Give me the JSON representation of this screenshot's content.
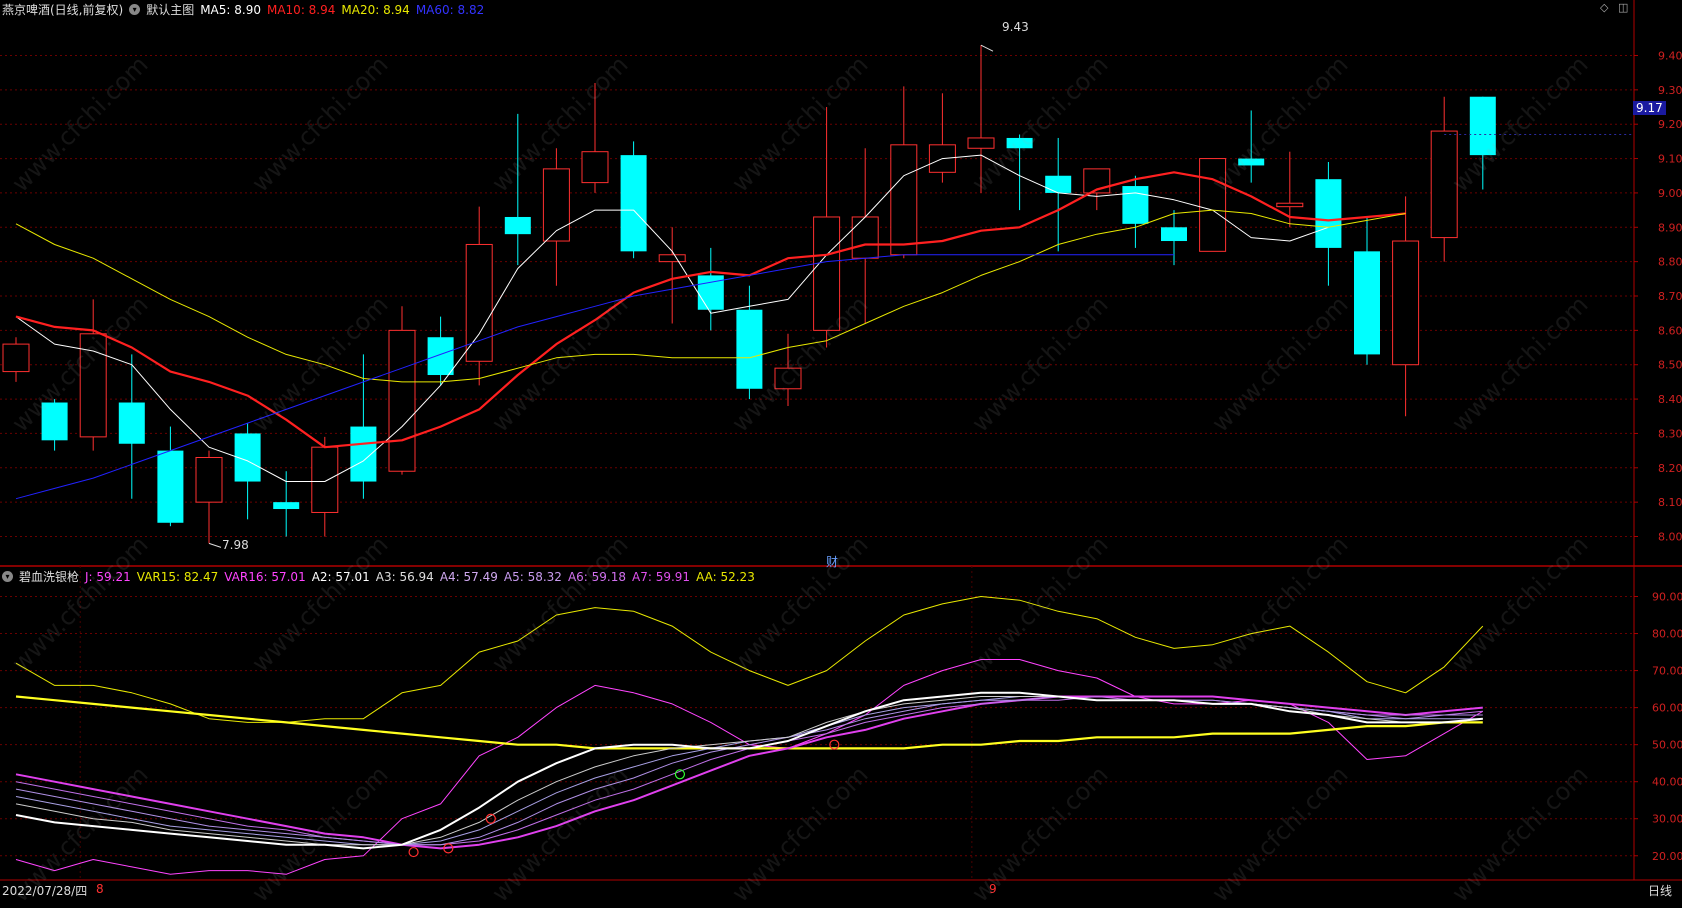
{
  "header": {
    "stock": "燕京啤酒(日线,前复权)",
    "main_chart": "默认主图",
    "ma": [
      {
        "label": "MA5: 8.90",
        "color": "#ffffff"
      },
      {
        "label": "MA10: 8.94",
        "color": "#ff2020"
      },
      {
        "label": "MA20: 8.94",
        "color": "#e8e800"
      },
      {
        "label": "MA60: 8.82",
        "color": "#2222ff"
      }
    ]
  },
  "indicator_header": {
    "name": "碧血洗银枪",
    "items": [
      {
        "label": "J: 59.21",
        "color": "#ff44ff"
      },
      {
        "label": "VAR15: 82.47",
        "color": "#e8e800"
      },
      {
        "label": "VAR16: 57.01",
        "color": "#ff44ff"
      },
      {
        "label": "A2: 57.01",
        "color": "#ffffff"
      },
      {
        "label": "A3: 56.94",
        "color": "#dddddd"
      },
      {
        "label": "A4: 57.49",
        "color": "#cfa8ef"
      },
      {
        "label": "A5: 58.32",
        "color": "#c79aee"
      },
      {
        "label": "A6: 59.18",
        "color": "#d070ee"
      },
      {
        "label": "A7: 59.91",
        "color": "#e050ee"
      },
      {
        "label": "AA: 52.23",
        "color": "#e8e800"
      }
    ]
  },
  "footer": {
    "date": "2022/07/28/四",
    "month_markers": [
      "8",
      "9"
    ],
    "period": "日线",
    "finance_marker": "财"
  },
  "price_labels": {
    "current": "9.17",
    "high": "9.43",
    "low": "7.98"
  },
  "watermark": "www.cfchi.com",
  "chart_data": [
    {
      "type": "candlestick",
      "ylim": [
        7.92,
        9.48
      ],
      "yticks": [
        "8.00",
        "8.10",
        "8.20",
        "8.30",
        "8.40",
        "8.50",
        "8.60",
        "8.70",
        "8.80",
        "8.90",
        "9.00",
        "9.10",
        "9.20",
        "9.30",
        "9.40"
      ],
      "candles": [
        {
          "o": 8.48,
          "c": 8.56,
          "h": 8.58,
          "l": 8.45
        },
        {
          "o": 8.39,
          "c": 8.28,
          "h": 8.4,
          "l": 8.25
        },
        {
          "o": 8.29,
          "c": 8.59,
          "h": 8.69,
          "l": 8.25
        },
        {
          "o": 8.39,
          "c": 8.27,
          "h": 8.53,
          "l": 8.11
        },
        {
          "o": 8.25,
          "c": 8.04,
          "h": 8.32,
          "l": 8.03
        },
        {
          "o": 8.1,
          "c": 8.23,
          "h": 8.25,
          "l": 7.98
        },
        {
          "o": 8.3,
          "c": 8.16,
          "h": 8.33,
          "l": 8.05
        },
        {
          "o": 8.1,
          "c": 8.08,
          "h": 8.19,
          "l": 8.0
        },
        {
          "o": 8.07,
          "c": 8.26,
          "h": 8.29,
          "l": 8.0
        },
        {
          "o": 8.32,
          "c": 8.16,
          "h": 8.53,
          "l": 8.11
        },
        {
          "o": 8.19,
          "c": 8.6,
          "h": 8.67,
          "l": 8.18
        },
        {
          "o": 8.58,
          "c": 8.47,
          "h": 8.64,
          "l": 8.44
        },
        {
          "o": 8.51,
          "c": 8.85,
          "h": 8.96,
          "l": 8.44
        },
        {
          "o": 8.93,
          "c": 8.88,
          "h": 9.23,
          "l": 8.79
        },
        {
          "o": 8.86,
          "c": 9.07,
          "h": 9.13,
          "l": 8.73
        },
        {
          "o": 9.03,
          "c": 9.12,
          "h": 9.32,
          "l": 9.0
        },
        {
          "o": 9.11,
          "c": 8.83,
          "h": 9.15,
          "l": 8.81
        },
        {
          "o": 8.8,
          "c": 8.82,
          "h": 8.9,
          "l": 8.62
        },
        {
          "o": 8.76,
          "c": 8.66,
          "h": 8.84,
          "l": 8.6
        },
        {
          "o": 8.66,
          "c": 8.43,
          "h": 8.73,
          "l": 8.4
        },
        {
          "o": 8.43,
          "c": 8.49,
          "h": 8.59,
          "l": 8.38
        },
        {
          "o": 8.6,
          "c": 8.93,
          "h": 9.25,
          "l": 8.55
        },
        {
          "o": 8.81,
          "c": 8.93,
          "h": 9.13,
          "l": 8.62
        },
        {
          "o": 8.82,
          "c": 9.14,
          "h": 9.31,
          "l": 8.81
        },
        {
          "o": 9.06,
          "c": 9.14,
          "h": 9.29,
          "l": 9.03
        },
        {
          "o": 9.13,
          "c": 9.16,
          "h": 9.43,
          "l": 9.0
        },
        {
          "o": 9.16,
          "c": 9.13,
          "h": 9.17,
          "l": 8.95
        },
        {
          "o": 9.05,
          "c": 9.0,
          "h": 9.16,
          "l": 8.83
        },
        {
          "o": 9.0,
          "c": 9.07,
          "h": 9.07,
          "l": 8.95
        },
        {
          "o": 9.02,
          "c": 8.91,
          "h": 9.05,
          "l": 8.84
        },
        {
          "o": 8.9,
          "c": 8.86,
          "h": 8.95,
          "l": 8.79
        },
        {
          "o": 8.83,
          "c": 9.1,
          "h": 9.1,
          "l": 8.83
        },
        {
          "o": 9.1,
          "c": 9.08,
          "h": 9.24,
          "l": 9.03
        },
        {
          "o": 8.96,
          "c": 8.97,
          "h": 9.12,
          "l": 8.9
        },
        {
          "o": 9.04,
          "c": 8.84,
          "h": 9.09,
          "l": 8.73
        },
        {
          "o": 8.83,
          "c": 8.53,
          "h": 8.93,
          "l": 8.5
        },
        {
          "o": 8.5,
          "c": 8.86,
          "h": 8.99,
          "l": 8.35
        },
        {
          "o": 8.87,
          "c": 9.18,
          "h": 9.28,
          "l": 8.8
        },
        {
          "o": 9.28,
          "c": 9.11,
          "h": 9.28,
          "l": 9.01
        }
      ],
      "series": [
        {
          "name": "MA5",
          "color": "#ffffff",
          "width": 1,
          "values": [
            8.64,
            8.56,
            8.54,
            8.5,
            8.37,
            8.26,
            8.22,
            8.16,
            8.16,
            8.22,
            8.32,
            8.44,
            8.59,
            8.78,
            8.89,
            8.95,
            8.95,
            8.83,
            8.65,
            8.67,
            8.69,
            8.82,
            8.93,
            9.05,
            9.1,
            9.11,
            9.05,
            9.0,
            8.99,
            9.0,
            8.98,
            8.95,
            8.87,
            8.86,
            8.9
          ]
        },
        {
          "name": "MA10",
          "color": "#ff2020",
          "width": 2.2,
          "values": [
            8.64,
            8.61,
            8.6,
            8.55,
            8.48,
            8.45,
            8.41,
            8.34,
            8.26,
            8.27,
            8.28,
            8.32,
            8.37,
            8.47,
            8.56,
            8.63,
            8.71,
            8.75,
            8.77,
            8.76,
            8.81,
            8.82,
            8.85,
            8.85,
            8.86,
            8.89,
            8.9,
            8.95,
            9.01,
            9.04,
            9.06,
            9.04,
            8.99,
            8.93,
            8.92,
            8.93,
            8.94
          ]
        },
        {
          "name": "MA20",
          "color": "#e8e800",
          "width": 1,
          "values": [
            8.91,
            8.85,
            8.81,
            8.75,
            8.69,
            8.64,
            8.58,
            8.53,
            8.5,
            8.46,
            8.45,
            8.45,
            8.46,
            8.49,
            8.52,
            8.53,
            8.53,
            8.52,
            8.52,
            8.52,
            8.55,
            8.57,
            8.62,
            8.67,
            8.71,
            8.76,
            8.8,
            8.85,
            8.88,
            8.9,
            8.94,
            8.95,
            8.94,
            8.91,
            8.9,
            8.92,
            8.94
          ]
        },
        {
          "name": "MA60",
          "color": "#2222ff",
          "width": 1,
          "values": [
            8.11,
            8.14,
            8.17,
            8.21,
            8.25,
            8.29,
            8.33,
            8.37,
            8.41,
            8.45,
            8.49,
            8.53,
            8.57,
            8.61,
            8.64,
            8.67,
            8.7,
            8.72,
            8.74,
            8.76,
            8.78,
            8.8,
            8.81,
            8.82,
            8.82,
            8.82,
            8.82,
            8.82,
            8.82,
            8.82,
            8.82
          ]
        }
      ]
    },
    {
      "type": "line",
      "ylim": [
        14,
        95
      ],
      "yticks": [
        "20.00",
        "30.00",
        "40.00",
        "50.00",
        "60.00",
        "70.00",
        "80.00",
        "90.00"
      ],
      "series": [
        {
          "name": "VAR15",
          "color": "#e8e800",
          "width": 1,
          "values": [
            72,
            66,
            66,
            64,
            61,
            57,
            56,
            56,
            57,
            57,
            64,
            66,
            75,
            78,
            85,
            87,
            86,
            82,
            75,
            70,
            66,
            70,
            78,
            85,
            88,
            90,
            89,
            86,
            84,
            79,
            76,
            77,
            80,
            82,
            75,
            67,
            64,
            71,
            82
          ]
        },
        {
          "name": "J",
          "color": "#ff44ff",
          "width": 1,
          "values": [
            19,
            16,
            19,
            17,
            15,
            16,
            16,
            15,
            19,
            20,
            30,
            34,
            47,
            52,
            60,
            66,
            64,
            61,
            56,
            50,
            49,
            53,
            58,
            66,
            70,
            73,
            73,
            70,
            68,
            63,
            61,
            61,
            62,
            61,
            56,
            46,
            47,
            53,
            59
          ]
        },
        {
          "name": "AA",
          "color": "#ffff20",
          "width": 2.2,
          "values": [
            63,
            62,
            61,
            60,
            59,
            58,
            57,
            56,
            55,
            54,
            53,
            52,
            51,
            50,
            50,
            49,
            49,
            49,
            49,
            49,
            49,
            49,
            49,
            49,
            50,
            50,
            51,
            51,
            52,
            52,
            52,
            53,
            53,
            53,
            54,
            55,
            55,
            56,
            56
          ]
        },
        {
          "name": "A7",
          "color": "#e040ee",
          "width": 2,
          "values": [
            42,
            40,
            38,
            36,
            34,
            32,
            30,
            28,
            26,
            25,
            23,
            22,
            23,
            25,
            28,
            32,
            35,
            39,
            43,
            47,
            49,
            52,
            54,
            57,
            59,
            61,
            62,
            63,
            63,
            63,
            63,
            63,
            62,
            61,
            60,
            59,
            58,
            59,
            60
          ]
        },
        {
          "name": "A6",
          "color": "#c070e8",
          "width": 1,
          "values": [
            40,
            38,
            36,
            34,
            32,
            30,
            28,
            27,
            25,
            24,
            23,
            23,
            24,
            27,
            31,
            35,
            38,
            42,
            46,
            49,
            51,
            53,
            56,
            58,
            60,
            61,
            62,
            62,
            63,
            62,
            62,
            62,
            61,
            60,
            59,
            58,
            58,
            58,
            59
          ]
        },
        {
          "name": "A5",
          "color": "#b090e6",
          "width": 1,
          "values": [
            38,
            36,
            34,
            32,
            30,
            28,
            27,
            26,
            25,
            24,
            23,
            23,
            25,
            29,
            34,
            38,
            41,
            45,
            48,
            50,
            52,
            54,
            57,
            59,
            61,
            62,
            62,
            63,
            62,
            62,
            62,
            62,
            61,
            60,
            59,
            58,
            57,
            58,
            58
          ]
        },
        {
          "name": "A4",
          "color": "#a8a0e4",
          "width": 1,
          "values": [
            36,
            34,
            32,
            30,
            28,
            27,
            26,
            25,
            24,
            23,
            23,
            24,
            27,
            32,
            37,
            41,
            44,
            47,
            49,
            51,
            52,
            55,
            58,
            60,
            61,
            62,
            63,
            63,
            62,
            62,
            62,
            61,
            61,
            60,
            59,
            57,
            57,
            57,
            57
          ]
        },
        {
          "name": "A3",
          "color": "#cccccc",
          "width": 1,
          "values": [
            34,
            32,
            30,
            29,
            27,
            26,
            25,
            24,
            23,
            23,
            23,
            25,
            29,
            35,
            40,
            44,
            47,
            49,
            50,
            51,
            52,
            56,
            59,
            61,
            62,
            63,
            63,
            63,
            62,
            62,
            62,
            61,
            61,
            60,
            58,
            57,
            56,
            56,
            57
          ]
        },
        {
          "name": "A2",
          "color": "#ffffff",
          "width": 2,
          "values": [
            31,
            29,
            28,
            27,
            26,
            25,
            24,
            23,
            23,
            22,
            23,
            27,
            33,
            40,
            45,
            49,
            50,
            50,
            49,
            49,
            51,
            55,
            59,
            62,
            63,
            64,
            64,
            63,
            62,
            62,
            62,
            61,
            61,
            59,
            58,
            56,
            56,
            56,
            57
          ]
        }
      ],
      "markers": [
        {
          "i": 10.3,
          "v": 21,
          "color": "#ff3030"
        },
        {
          "i": 11.2,
          "v": 22,
          "color": "#ff3030"
        },
        {
          "i": 12.3,
          "v": 30,
          "color": "#ff3030"
        },
        {
          "i": 17.2,
          "v": 42,
          "color": "#30ff30"
        },
        {
          "i": 21.2,
          "v": 50,
          "color": "#ff3030"
        }
      ]
    }
  ]
}
